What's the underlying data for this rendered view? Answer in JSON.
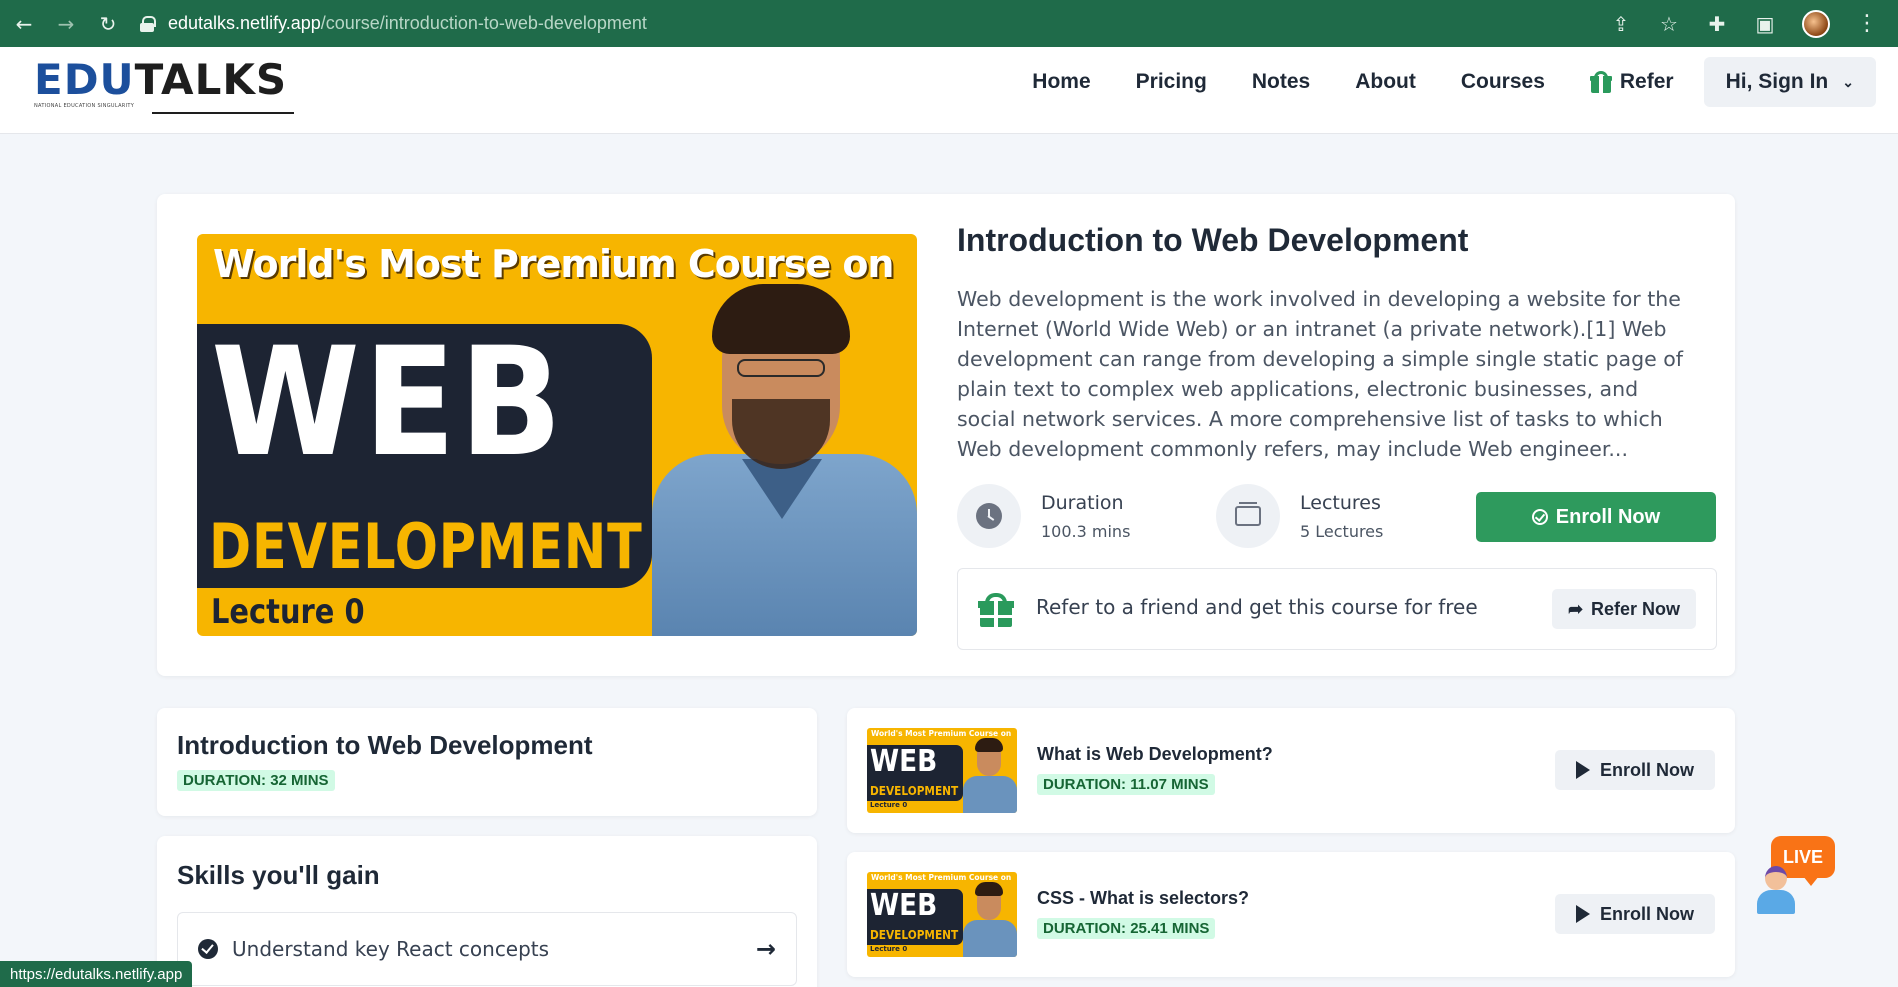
{
  "browser": {
    "url_host": "edutalks.netlify.app",
    "url_path": "/course/introduction-to-web-development",
    "status_url": "https://edutalks.netlify.app"
  },
  "logo": {
    "part1": "EDU",
    "part2": "TALKS",
    "tagline": "NATIONAL EDUCATION SINGULARITY"
  },
  "nav": {
    "home": "Home",
    "pricing": "Pricing",
    "notes": "Notes",
    "about": "About",
    "courses": "Courses",
    "refer": "Refer",
    "signin": "Hi, Sign In"
  },
  "course": {
    "title": "Introduction to Web Development",
    "description": "Web development is the work involved in developing a website for the Internet (World Wide Web) or an intranet (a private network).[1] Web development can range from developing a simple single static page of plain text to complex web applications, electronic businesses, and social network services. A more comprehensive list of tasks to which Web development commonly refers, may include Web engineer...",
    "duration_label": "Duration",
    "duration_value": "100.3 mins",
    "lectures_label": "Lectures",
    "lectures_value": "5 Lectures",
    "enroll_label": "Enroll Now",
    "refer_text": "Refer to a friend and get this course for free",
    "refer_button": "Refer Now"
  },
  "thumbnail": {
    "headline": "World's Most Premium Course on",
    "word1": "WEB",
    "word2": "DEVELOPMENT",
    "lecture": "Lecture 0"
  },
  "info_card": {
    "title": "Introduction to Web Development",
    "duration": "DURATION: 32 MINS"
  },
  "skills": {
    "title": "Skills you'll gain",
    "items": [
      {
        "label": "Understand key React concepts"
      }
    ]
  },
  "lectures": [
    {
      "title": "What is Web Development?",
      "duration": "DURATION: 11.07 MINS",
      "button": "Enroll Now"
    },
    {
      "title": "CSS - What is selectors?",
      "duration": "DURATION: 25.41 MINS",
      "button": "Enroll Now"
    }
  ],
  "live_widget": {
    "label": "LIVE"
  },
  "colors": {
    "browser_green": "#1f6b4a",
    "brand_green": "#2e9a5d",
    "thumbnail_yellow": "#f7b500",
    "dark_navy": "#1d2433",
    "live_orange": "#f97316"
  },
  "icons": [
    "back-icon",
    "forward-icon",
    "reload-icon",
    "lock-icon",
    "share-icon",
    "star-icon",
    "extensions-icon",
    "sidebar-icon",
    "profile-avatar",
    "kebab-menu-icon",
    "gift-icon",
    "chevron-down-icon",
    "clock-icon",
    "layers-icon",
    "check-circle-icon",
    "arrow-right-icon",
    "play-icon"
  ]
}
